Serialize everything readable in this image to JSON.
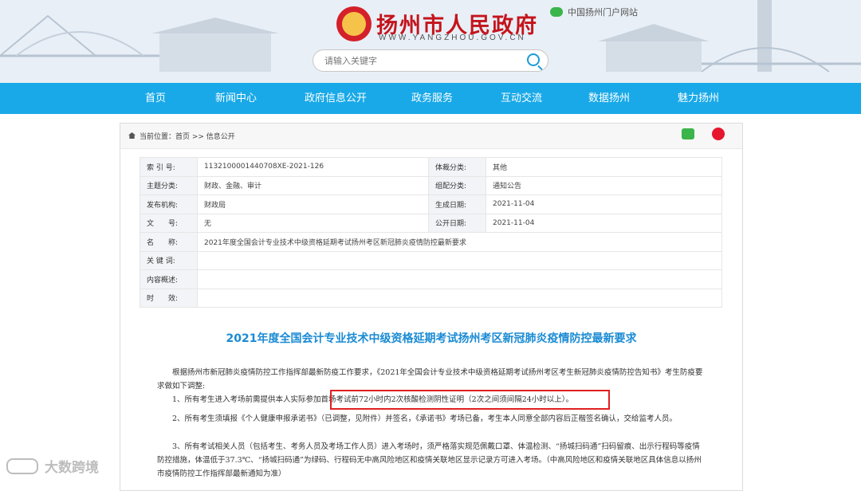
{
  "header": {
    "title": "扬州市人民政府",
    "url": "WWW.YANGZHOU.GOV.CN",
    "portal_label": "中国扬州门户网站",
    "search_placeholder": "请输入关键字"
  },
  "nav": [
    "首页",
    "新闻中心",
    "政府信息公开",
    "政务服务",
    "互动交流",
    "数据扬州",
    "魅力扬州"
  ],
  "breadcrumb": "当前位置：首页 >> 信息公开",
  "meta": {
    "index_label": "索 引 号:",
    "index_value": "1132100001440708XE-2021-126",
    "genre_label": "体裁分类:",
    "genre_value": "其他",
    "topic_label": "主题分类:",
    "topic_value": "财政、金融、审计",
    "group_label": "组配分类:",
    "group_value": "通知公告",
    "org_label": "发布机构:",
    "org_value": "财政局",
    "created_label": "生成日期:",
    "created_value": "2021-11-04",
    "docno_label": "文　　号:",
    "docno_value": "无",
    "published_label": "公开日期:",
    "published_value": "2021-11-04",
    "name_label": "名　　称:",
    "name_value": "2021年度全国会计专业技术中级资格延期考试扬州考区新冠肺炎疫情防控最新要求",
    "keywords_label": "关 键 词:",
    "keywords_value": "",
    "summary_label": "内容概述:",
    "summary_value": "",
    "validity_label": "时　　效:",
    "validity_value": ""
  },
  "article": {
    "title": "2021年度全国会计专业技术中级资格延期考试扬州考区新冠肺炎疫情防控最新要求",
    "p1": "根据扬州市新冠肺炎疫情防控工作指挥部最新防疫工作要求，《2021年全国会计专业技术中级资格延期考试扬州考区考生新冠肺炎疫情防控告知书》考生防疫要求做如下调整:",
    "p2": "1、所有考生进入考场前需提供本人实际参加首场考试前72小时内2次核酸检测阴性证明（2次之间须间隔24小时以上）。",
    "p3": "2、所有考生须填报《个人健康申报承诺书》（已调整，见附件）并签名，《承诺书》考场已备，考生本人同意全部内容后正楷签名确认，交给监考人员。",
    "p4": "3、所有考试相关人员（包括考生、考务人员及考场工作人员）进入考场时，须严格落实规范佩戴口罩、体温检测、“扬城扫码通”扫码留痕、出示行程码等疫情防控措施，体温低于37.3℃、“扬城扫码通”为绿码、行程码无中高风险地区和疫情关联地区显示记录方可进入考场。（中高风险地区和疫情关联地区具体信息以扬州市疫情防控工作指挥部最新通知为准）"
  },
  "watermark": "大数跨境"
}
